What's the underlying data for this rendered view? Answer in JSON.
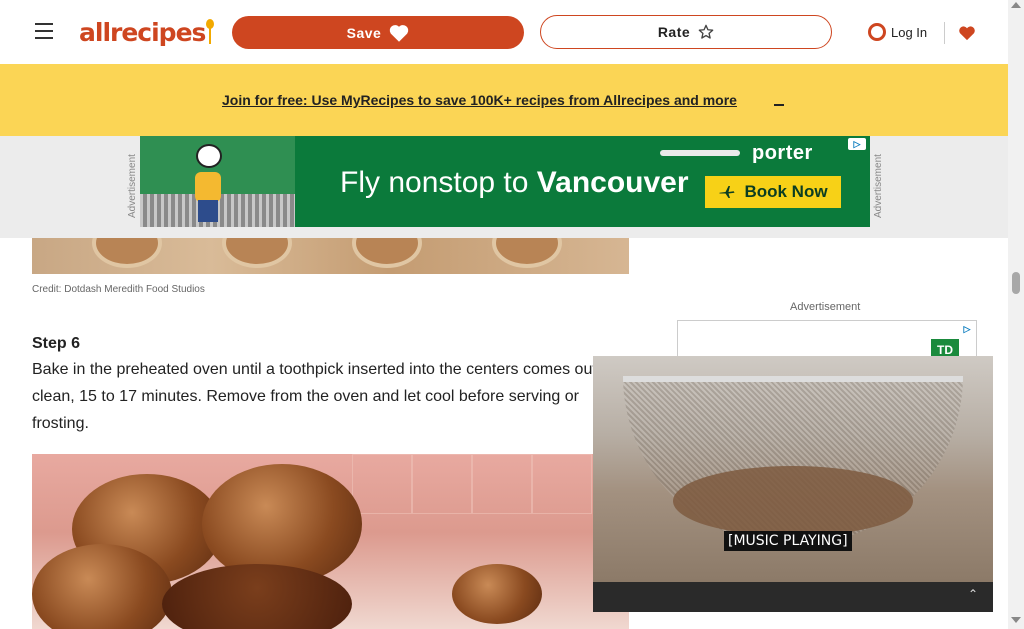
{
  "header": {
    "logo_text": "allrecipes",
    "save_label": "Save",
    "rate_label": "Rate",
    "login_label": "Log In"
  },
  "banner": {
    "link_text": "Join for free: Use MyRecipes to save 100K+ recipes from Allrecipes and more"
  },
  "ad_top": {
    "side_label": "Advertisement",
    "brand": "porter",
    "headline_prefix": "Fly nonstop to ",
    "headline_city": "Vancouver",
    "cta": "Book Now"
  },
  "article": {
    "credit": "Credit: Dotdash Meredith Food Studios",
    "step_title": "Step 6",
    "step_text": "Bake in the preheated oven until a toothpick inserted into the centers comes out clean, 15 to 17 minutes. Remove from the oven and let cool before serving or frosting."
  },
  "right_ad": {
    "label": "Advertisement",
    "brand_mark": "TD"
  },
  "video": {
    "caption": "[MUSIC PLAYING]"
  },
  "colors": {
    "brand": "#ce4620",
    "banner": "#fbd555",
    "ad_green": "#0b7a3b"
  }
}
